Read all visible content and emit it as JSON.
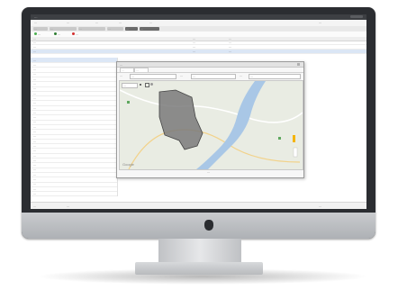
{
  "window": {
    "title": "…"
  },
  "menu": {
    "items": [
      "…",
      "…",
      "…",
      "…",
      "…"
    ]
  },
  "tabs": [
    {
      "label": "…",
      "active": false
    },
    {
      "label": "…",
      "active": false
    },
    {
      "label": "…",
      "active": false
    },
    {
      "label": "…",
      "active": false
    },
    {
      "label": "…",
      "active": true
    },
    {
      "label": "…",
      "active": true
    }
  ],
  "toolbar": {
    "buttons": [
      {
        "label": "…",
        "icon": "add-icon",
        "color": "#4caf50"
      },
      {
        "label": "…",
        "icon": "edit-icon",
        "color": "#2e7d32"
      },
      {
        "label": "…",
        "icon": "delete-icon",
        "color": "#d32f2f"
      }
    ]
  },
  "list_header": {
    "col1": "…",
    "col2": "…",
    "col3": "…"
  },
  "table_rows": [
    {
      "c1": "…",
      "c2": "…",
      "c3": "…"
    },
    {
      "c1": "…",
      "c2": "…",
      "c3": "…"
    },
    {
      "c1": "…",
      "c2": "…",
      "c3": "…"
    }
  ],
  "left_list": [
    "…",
    "…",
    "…",
    "…",
    "…",
    "…",
    "…",
    "…",
    "…",
    "…",
    "…",
    "…",
    "…",
    "…",
    "…",
    "…",
    "…",
    "…",
    "…",
    "…",
    "…",
    "…",
    "…",
    "…",
    "…",
    "…",
    "…",
    "…",
    "…"
  ],
  "dialog": {
    "title": "…",
    "tabs": [
      "…",
      "…"
    ],
    "fields": [
      {
        "label": "…",
        "value": "…"
      },
      {
        "label": "…",
        "value": "…"
      },
      {
        "label": "…",
        "value": "…"
      }
    ],
    "map": {
      "type_select": "…",
      "footer": "…"
    }
  },
  "status": {
    "left": "…",
    "page": "…",
    "right": "…"
  },
  "colors": {
    "bezel": "#2b2d31",
    "selection": "#dce7f6",
    "polygon_fill": "#7a7a7a",
    "river": "#a9c7e6"
  }
}
